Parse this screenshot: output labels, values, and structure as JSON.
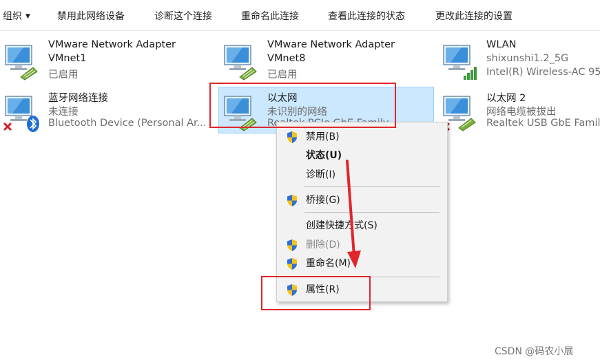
{
  "toolbar": {
    "organize": "组织",
    "disable": "禁用此网络设备",
    "diagnose": "诊断这个连接",
    "rename": "重命名此连接",
    "status": "查看此连接的状态",
    "settings": "更改此连接的设置"
  },
  "adapters": [
    {
      "name": "VMware Network Adapter",
      "line2": "VMnet1",
      "line3": "已启用",
      "icon": "network-adapter-icon"
    },
    {
      "name": "VMware Network Adapter",
      "line2": "VMnet8",
      "line3": "已启用",
      "icon": "network-adapter-icon"
    },
    {
      "name": "WLAN",
      "line2": "shixunshi1.2_5G",
      "line3": "Intel(R) Wireless-AC 95",
      "icon": "wifi-signal-icon"
    },
    {
      "name": "蓝牙网络连接",
      "line2": "未连接",
      "line3": "Bluetooth Device (Personal Ar...",
      "icon": "bluetooth-icon"
    },
    {
      "name": "以太网",
      "line2": "未识别的网络",
      "line3": "Realtek PCIe GbE Family",
      "icon": "network-adapter-icon"
    },
    {
      "name": "以太网 2",
      "line2": "网络电缆被拔出",
      "line3": "Realtek USB GbE Family",
      "icon": "cable-unplugged-icon"
    }
  ],
  "context_menu": {
    "items": [
      {
        "label": "禁用(B)",
        "shield": true
      },
      {
        "label": "状态(U)",
        "bold": true
      },
      {
        "label": "诊断(I)"
      },
      {
        "label": "桥接(G)",
        "shield": true
      },
      {
        "label": "创建快捷方式(S)"
      },
      {
        "label": "删除(D)",
        "shield": true,
        "disabled": true
      },
      {
        "label": "重命名(M)",
        "shield": true
      },
      {
        "label": "属性(R)",
        "shield": true
      }
    ]
  },
  "watermark": "CSDN @码农小展",
  "colors": {
    "selection": "#cce8ff",
    "highlight_box": "#e0262b",
    "arrow": "#e0262b"
  }
}
